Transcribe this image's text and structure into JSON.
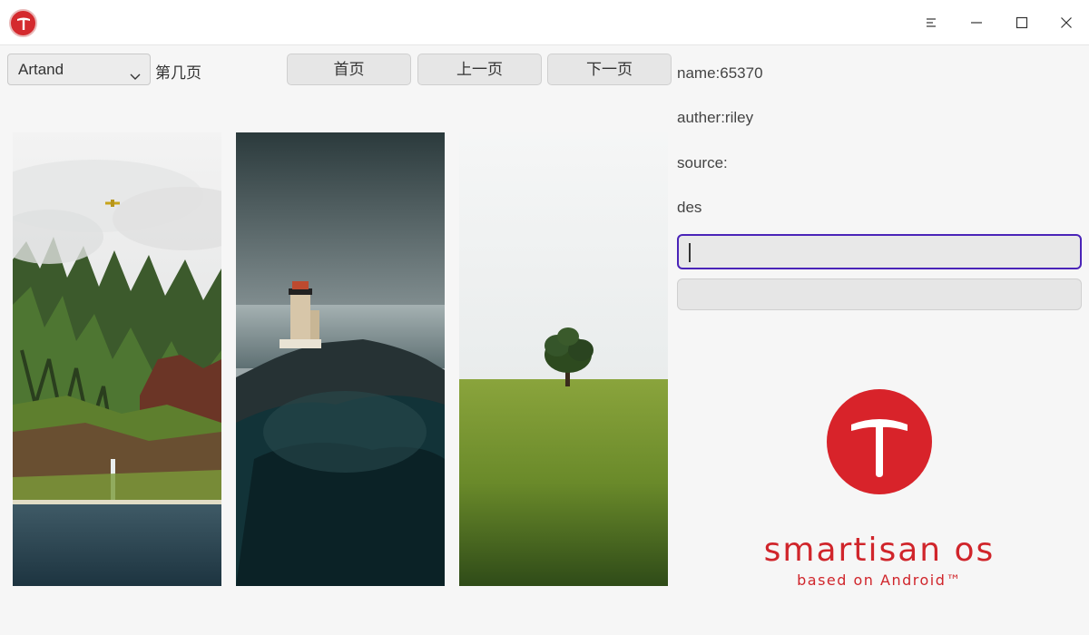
{
  "window": {
    "menu_icon": "menu-icon",
    "minimize_icon": "minimize-icon",
    "maximize_icon": "maximize-icon",
    "close_icon": "close-icon"
  },
  "toolbar": {
    "source_select": "Artand",
    "page_label": "第几页",
    "first_label": "首页",
    "prev_label": "上一页",
    "next_label": "下一页"
  },
  "info": {
    "name": "name:65370",
    "author": "auther:riley",
    "source": "source:",
    "des": "des",
    "input_value": "",
    "input2_value": ""
  },
  "brand": {
    "name": "smartisan os",
    "sub": "based on Android™",
    "color": "#d0252b"
  },
  "photos": [
    "mountain-waterfall-photo",
    "lighthouse-photo",
    "tree-field-photo"
  ]
}
